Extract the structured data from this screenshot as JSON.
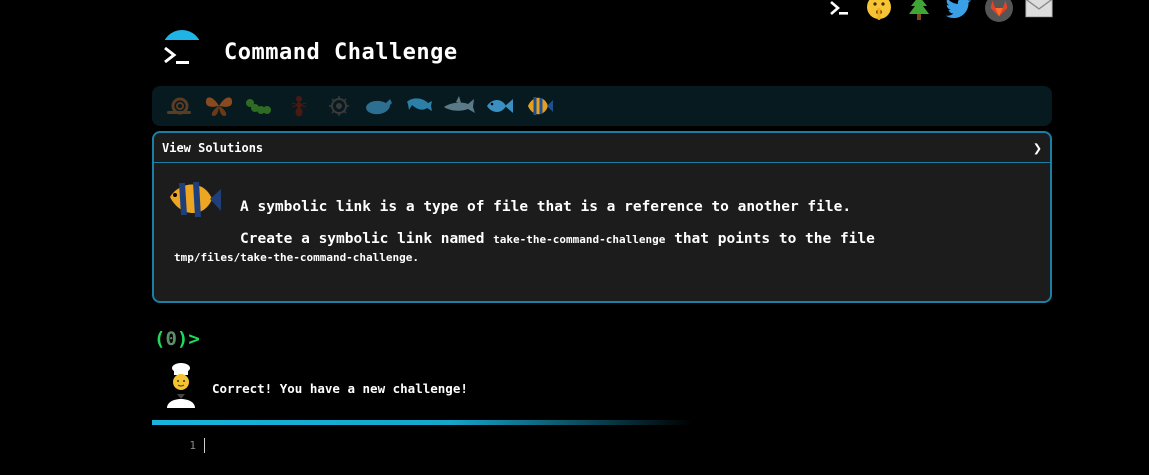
{
  "header": {
    "title": "Command Challenge"
  },
  "social": [
    {
      "name": "terminal-icon"
    },
    {
      "name": "shushing-face-icon"
    },
    {
      "name": "tree-icon"
    },
    {
      "name": "twitter-icon"
    },
    {
      "name": "gitlab-icon"
    },
    {
      "name": "mail-icon"
    }
  ],
  "levels": [
    {
      "name": "snail-icon"
    },
    {
      "name": "butterfly-icon"
    },
    {
      "name": "caterpillar-icon"
    },
    {
      "name": "ant-icon"
    },
    {
      "name": "microbe-icon"
    },
    {
      "name": "whale-icon"
    },
    {
      "name": "dolphin-icon"
    },
    {
      "name": "shark-icon"
    },
    {
      "name": "fish-icon"
    },
    {
      "name": "tropical-fish-icon"
    }
  ],
  "card": {
    "head_label": "View Solutions",
    "line1": "A symbolic link is a type of file that is a reference to another file.",
    "line2_pre": "Create a symbolic link named ",
    "line2_code": "take-the-command-challenge",
    "line2_post": " that points to the file",
    "line3": "tmp/files/take-the-command-challenge."
  },
  "prompt": {
    "open": "(",
    "count": "0",
    "close": ")>"
  },
  "result": {
    "message": "Correct! You have a new challenge!"
  },
  "editor": {
    "line_number": "1"
  },
  "colors": {
    "accent": "#1fb4e6",
    "prompt": "#20d85a",
    "card_border": "#1a7fa3",
    "card_bg": "#1c1c1c"
  }
}
